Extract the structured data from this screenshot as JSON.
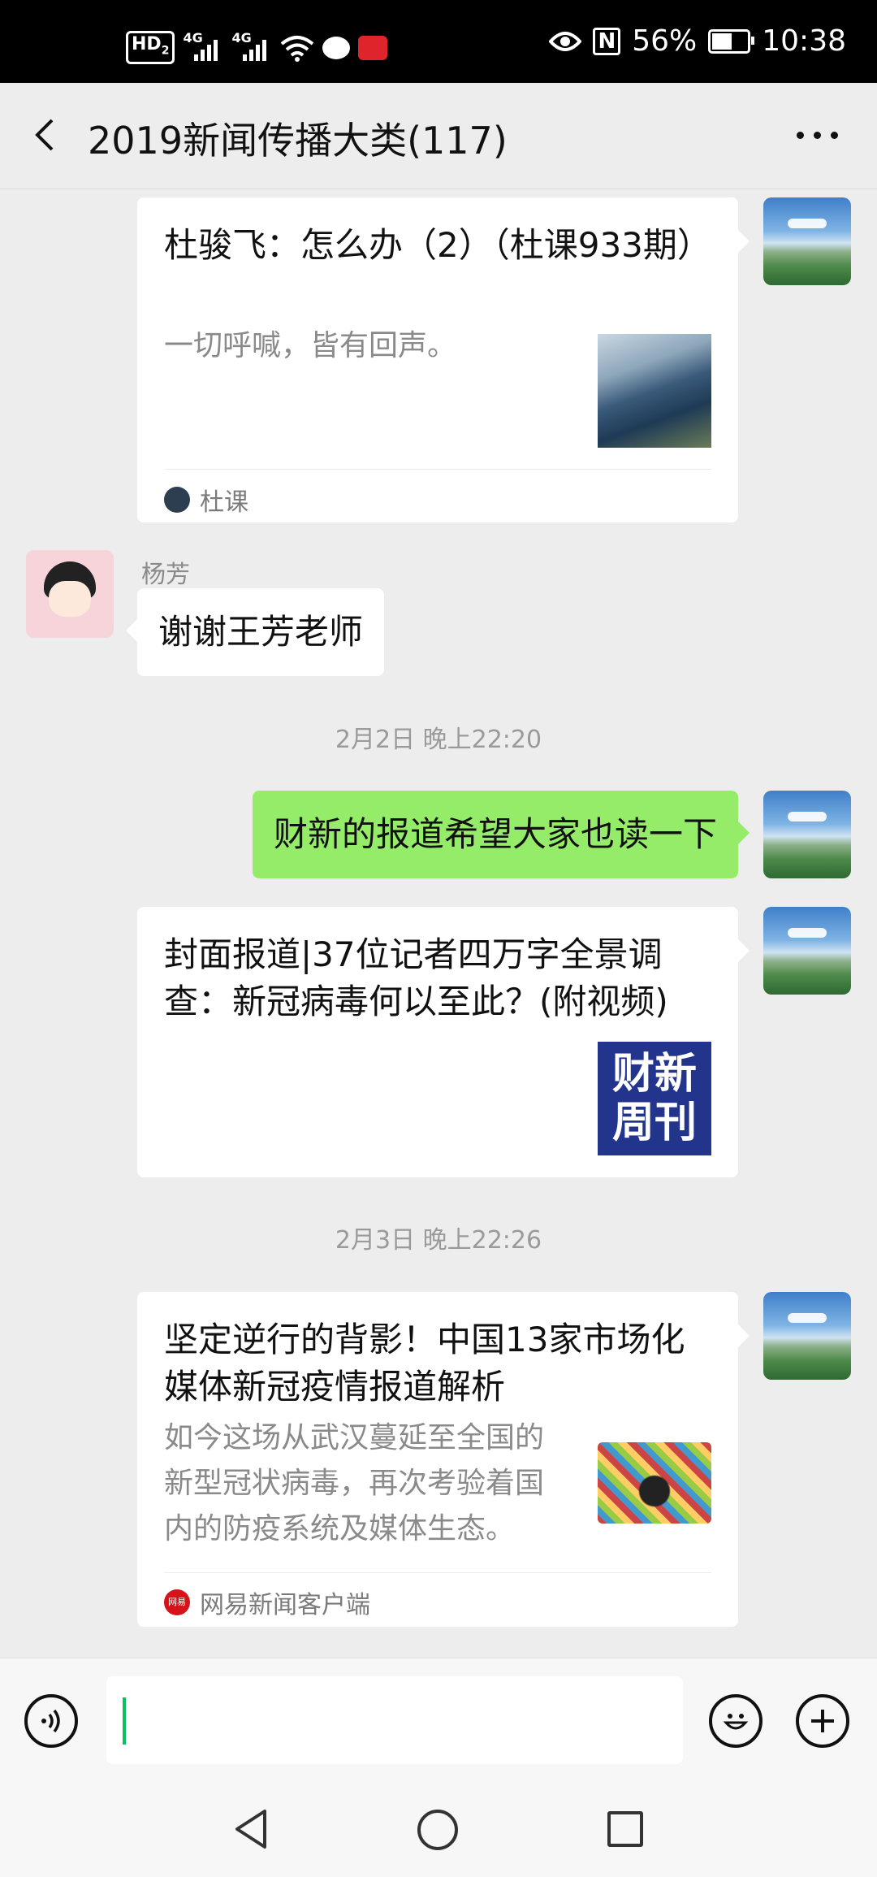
{
  "status_bar": {
    "hd_label": "HD",
    "hd_sub": "2",
    "sig1_label": "4G",
    "sig2_label": "4G",
    "battery_percent": "56%",
    "time": "10:38",
    "nfc_label": "N"
  },
  "header": {
    "title": "2019新闻传播大类(117)"
  },
  "messages": {
    "card1": {
      "title": "杜骏飞：怎么办（2）（杜课933期）",
      "desc": "一切呼喊，皆有回声。",
      "source": "杜课"
    },
    "msg_yangfang": {
      "sender": "杨芳",
      "text": "谢谢王芳老师"
    },
    "time1": "2月2日 晚上22:20",
    "msg_self1": {
      "text": "财新的报道希望大家也读一下"
    },
    "card2": {
      "title": "封面报道|37位记者四万字全景调查：新冠病毒何以至此？(附视频)",
      "thumb_text_line1": "财新",
      "thumb_text_line2": "周刊"
    },
    "time2": "2月3日 晚上22:26",
    "card3": {
      "title": "坚定逆行的背影！中国13家市场化媒体新冠疫情报道解析",
      "desc": "如今这场从武汉蔓延至全国的新型冠状病毒，再次考验着国内的防疫系统及媒体生态。",
      "source": "网易新闻客户端",
      "source_icon_text": "网易"
    }
  },
  "input_bar": {
    "value": ""
  },
  "colors": {
    "self_bubble": "#95ec69",
    "background": "#ededed",
    "caret": "#07c160",
    "caixin_blue": "#23348d"
  }
}
